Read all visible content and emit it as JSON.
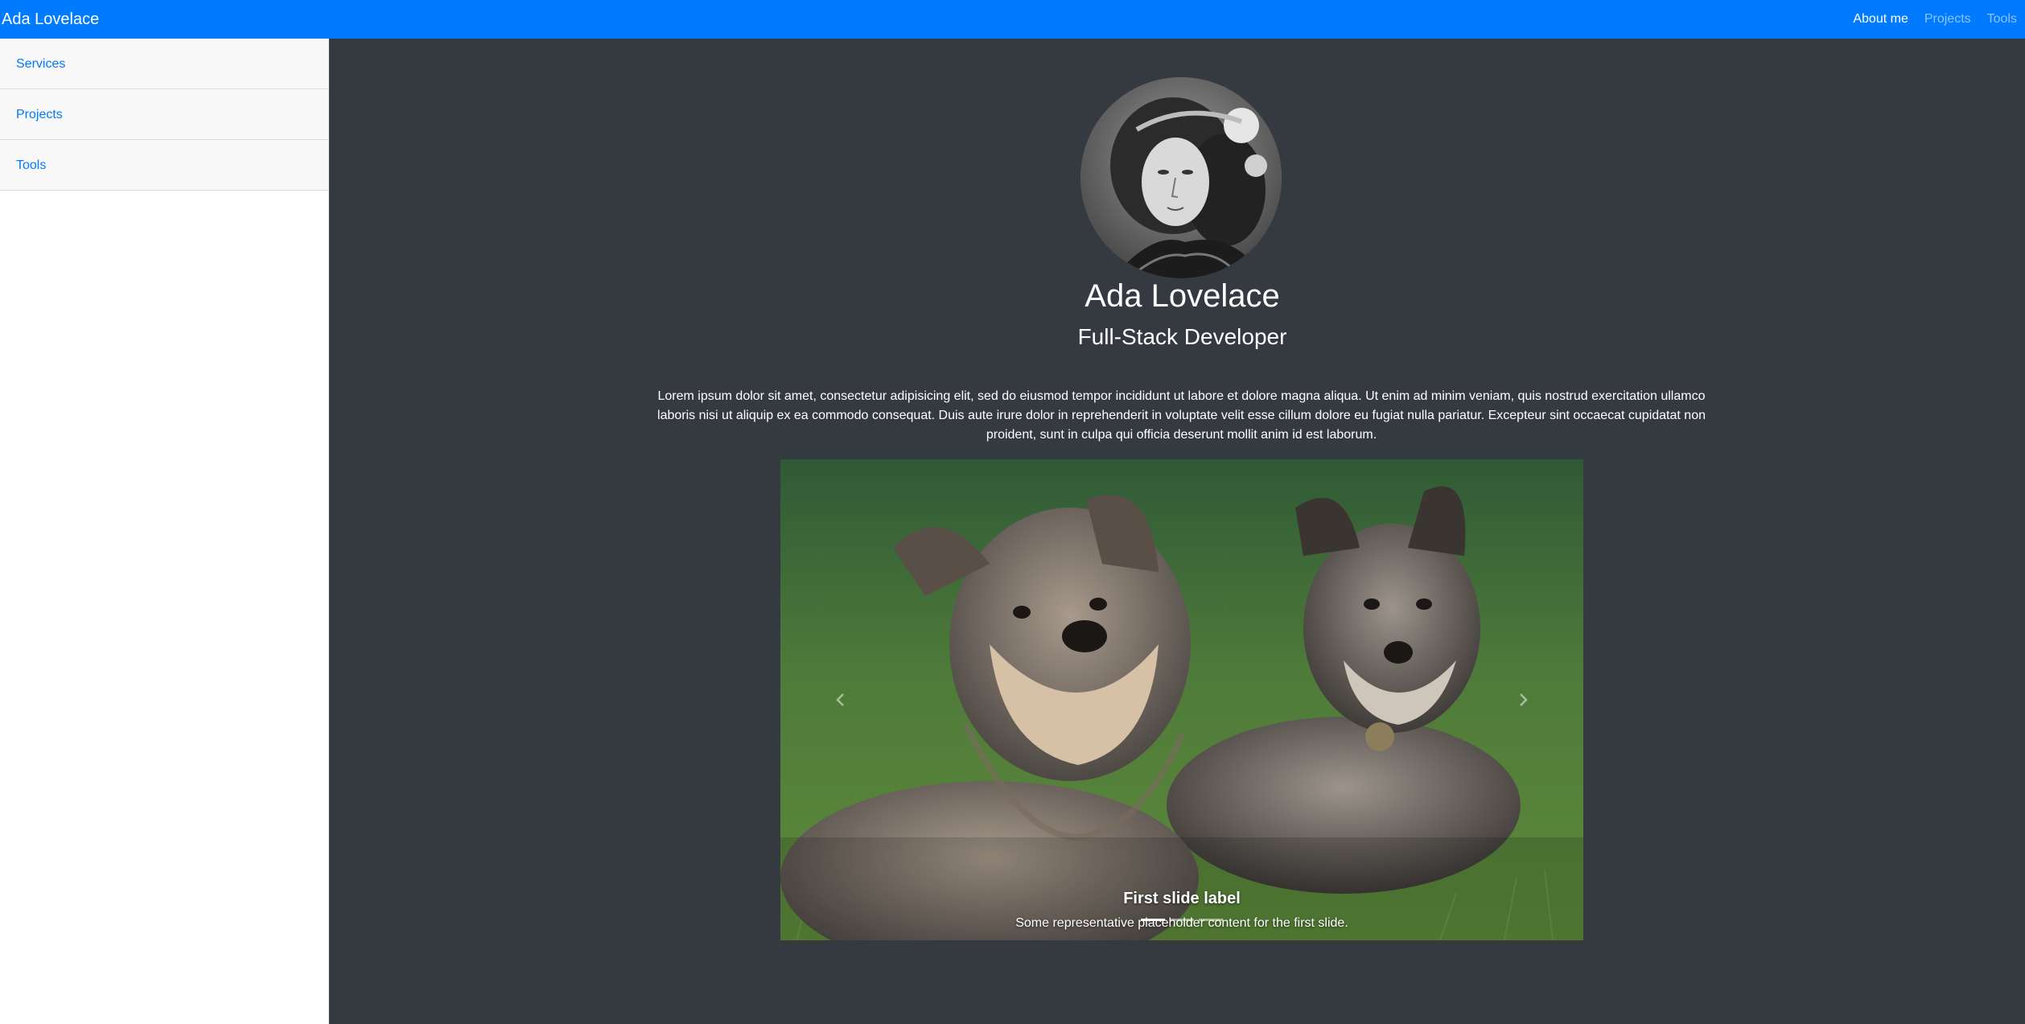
{
  "navbar": {
    "brand": "Ada Lovelace",
    "links": [
      "About me",
      "Projects",
      "Tools"
    ]
  },
  "sidebar": {
    "items": [
      "Services",
      "Projects",
      "Tools"
    ]
  },
  "profile": {
    "name": "Ada Lovelace",
    "title": "Full-Stack Developer",
    "bio": "Lorem ipsum dolor sit amet, consectetur adipisicing elit, sed do eiusmod tempor incididunt ut labore et dolore magna aliqua. Ut enim ad minim veniam, quis nostrud exercitation ullamco laboris nisi ut aliquip ex ea commodo consequat. Duis aute irure dolor in reprehenderit in voluptate velit esse cillum dolore eu fugiat nulla pariatur. Excepteur sint occaecat cupidatat non proident, sunt in culpa qui officia deserunt mollit anim id est laborum."
  },
  "carousel": {
    "slide_label": "First slide label",
    "slide_text": "Some representative placeholder content for the first slide.",
    "indicator_count": 3,
    "active_index": 0
  },
  "colors": {
    "navbar_bg": "#007bff",
    "page_bg": "#343a40",
    "link": "#007bff"
  }
}
